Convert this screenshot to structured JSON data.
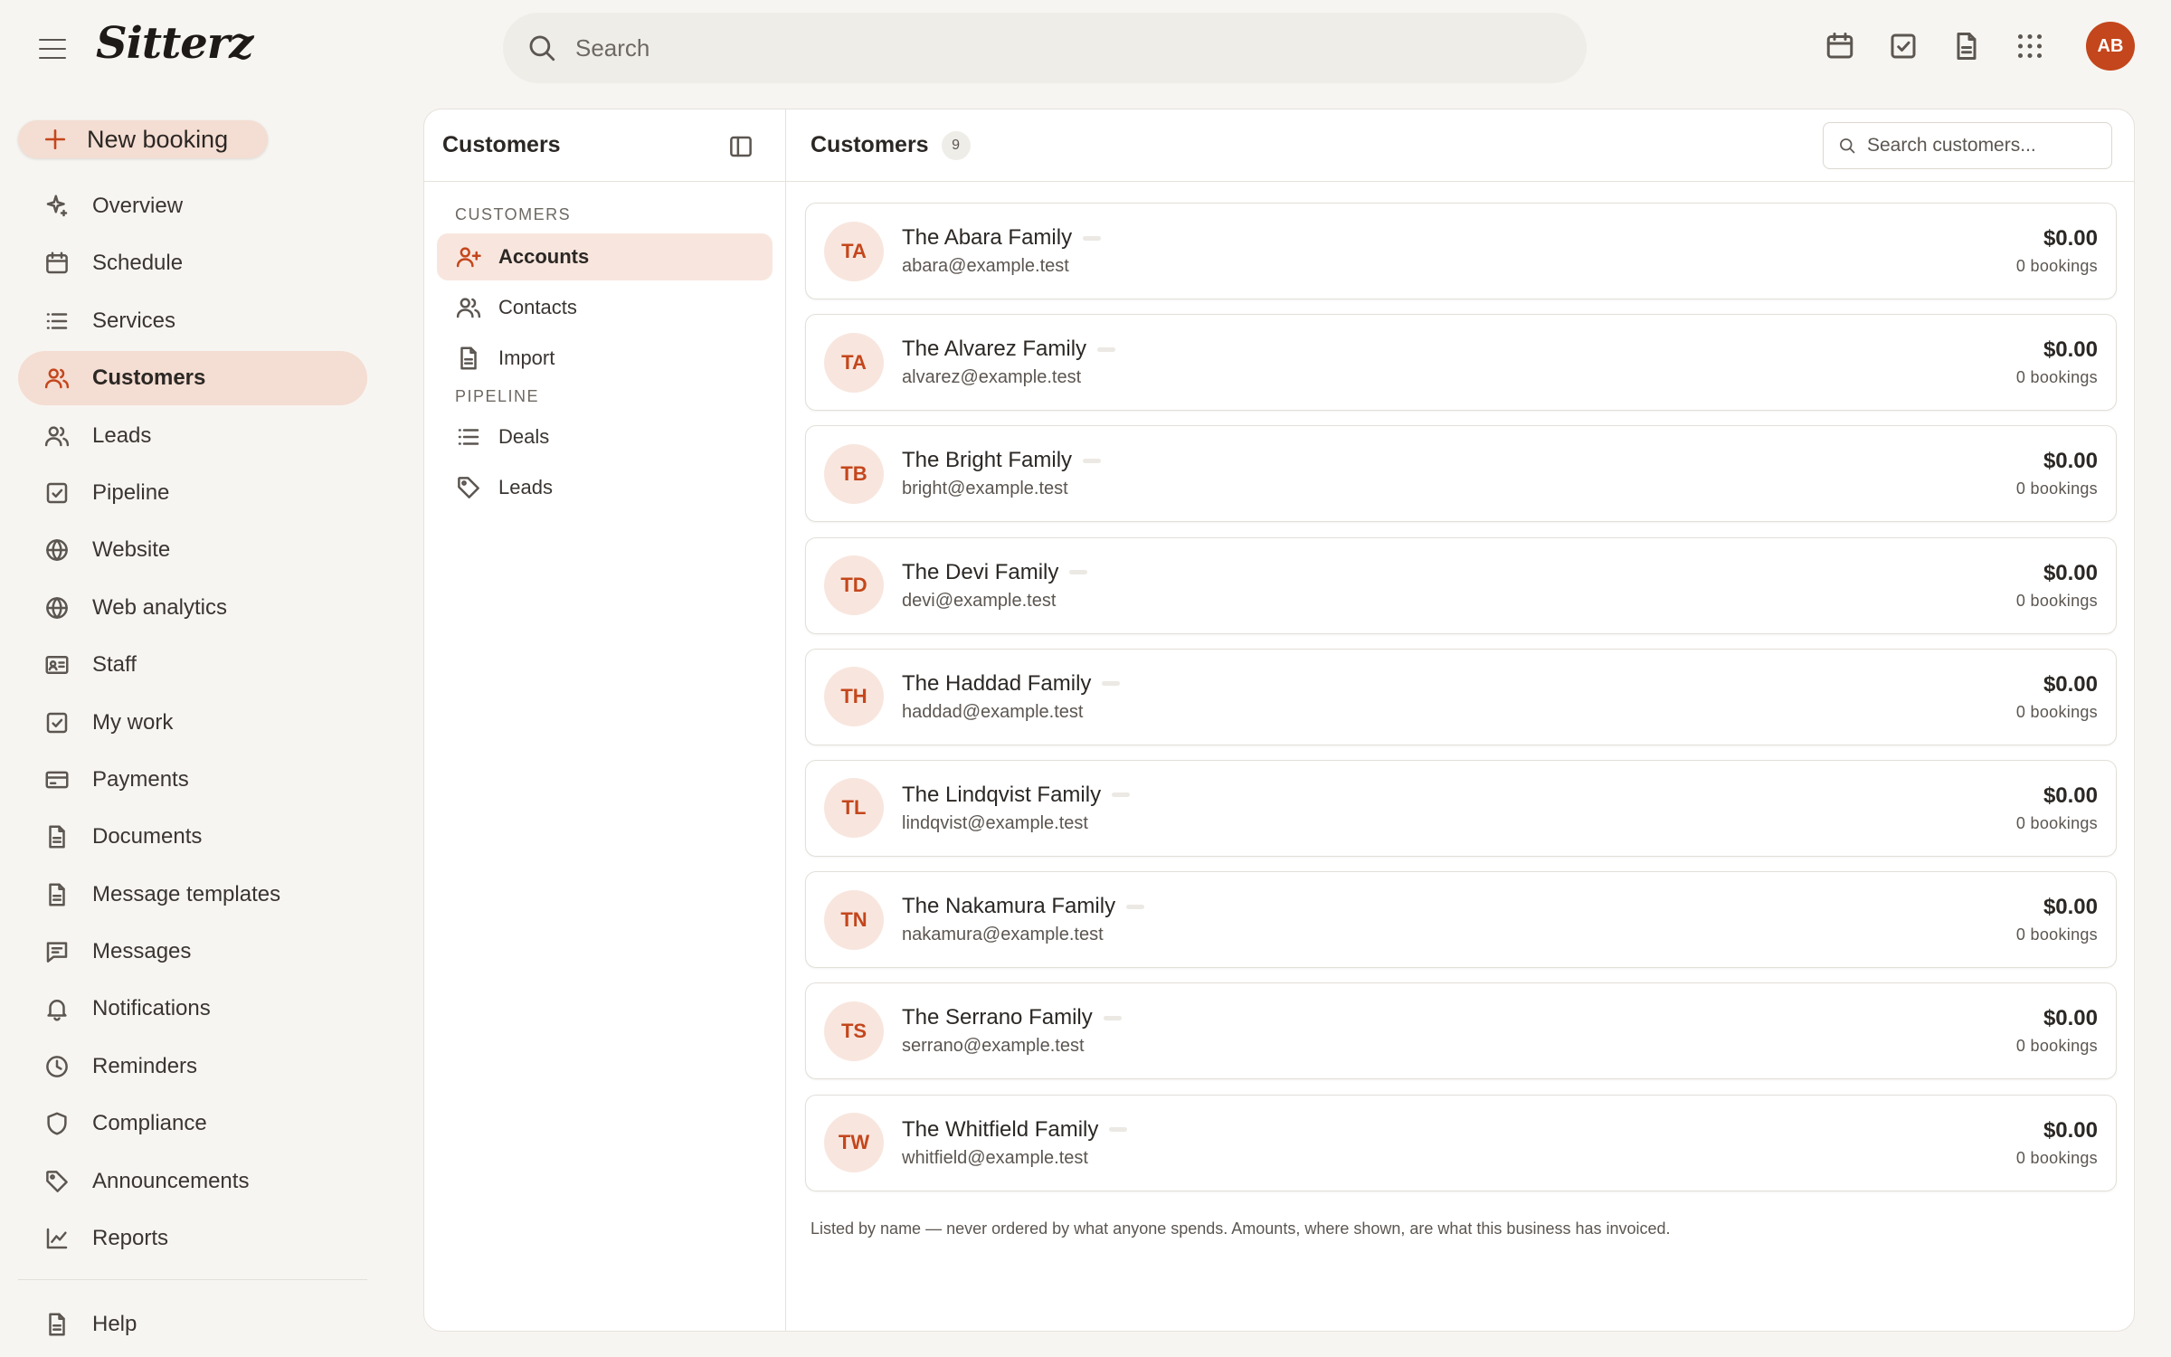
{
  "app": {
    "logo": "Sitterz",
    "user_initials": "AB",
    "accent": "#c4461c"
  },
  "search": {
    "placeholder": "Search"
  },
  "top_icons": [
    "calendar-icon",
    "check-square-icon",
    "document-icon",
    "apps-grid-icon"
  ],
  "sidebar": {
    "new_booking": "New booking",
    "items": [
      {
        "label": "Overview",
        "icon": "sparkle-icon"
      },
      {
        "label": "Schedule",
        "icon": "calendar-icon"
      },
      {
        "label": "Services",
        "icon": "list-icon"
      },
      {
        "label": "Customers",
        "icon": "users-icon",
        "active": true
      },
      {
        "label": "Leads",
        "icon": "users-icon"
      },
      {
        "label": "Pipeline",
        "icon": "check-square-icon"
      },
      {
        "label": "Website",
        "icon": "globe-icon"
      },
      {
        "label": "Web analytics",
        "icon": "globe-icon"
      },
      {
        "label": "Staff",
        "icon": "id-card-icon"
      },
      {
        "label": "My work",
        "icon": "check-square-icon"
      },
      {
        "label": "Payments",
        "icon": "credit-card-icon"
      },
      {
        "label": "Documents",
        "icon": "document-icon"
      },
      {
        "label": "Message templates",
        "icon": "document-icon"
      },
      {
        "label": "Messages",
        "icon": "message-icon"
      },
      {
        "label": "Notifications",
        "icon": "bell-icon"
      },
      {
        "label": "Reminders",
        "icon": "clock-icon"
      },
      {
        "label": "Compliance",
        "icon": "shield-icon"
      },
      {
        "label": "Announcements",
        "icon": "tag-icon"
      },
      {
        "label": "Reports",
        "icon": "chart-icon"
      }
    ],
    "help": {
      "label": "Help",
      "icon": "document-icon"
    }
  },
  "subnav": {
    "title": "Customers",
    "sections": [
      {
        "label": "CUSTOMERS",
        "items": [
          {
            "label": "Accounts",
            "icon": "user-plus-icon",
            "active": true
          },
          {
            "label": "Contacts",
            "icon": "users-icon"
          },
          {
            "label": "Import",
            "icon": "document-icon"
          }
        ]
      },
      {
        "label": "PIPELINE",
        "items": [
          {
            "label": "Deals",
            "icon": "list-icon"
          },
          {
            "label": "Leads",
            "icon": "tag-icon"
          }
        ]
      }
    ]
  },
  "content": {
    "title": "Customers",
    "count": "9",
    "search_placeholder": "Search customers...",
    "customers": [
      {
        "initials": "TA",
        "name": "The Abara Family",
        "email": "abara@example.test",
        "amount": "$0.00",
        "bookings": "0 bookings"
      },
      {
        "initials": "TA",
        "name": "The Alvarez Family",
        "email": "alvarez@example.test",
        "amount": "$0.00",
        "bookings": "0 bookings"
      },
      {
        "initials": "TB",
        "name": "The Bright Family",
        "email": "bright@example.test",
        "amount": "$0.00",
        "bookings": "0 bookings"
      },
      {
        "initials": "TD",
        "name": "The Devi Family",
        "email": "devi@example.test",
        "amount": "$0.00",
        "bookings": "0 bookings"
      },
      {
        "initials": "TH",
        "name": "The Haddad Family",
        "email": "haddad@example.test",
        "amount": "$0.00",
        "bookings": "0 bookings"
      },
      {
        "initials": "TL",
        "name": "The Lindqvist Family",
        "email": "lindqvist@example.test",
        "amount": "$0.00",
        "bookings": "0 bookings"
      },
      {
        "initials": "TN",
        "name": "The Nakamura Family",
        "email": "nakamura@example.test",
        "amount": "$0.00",
        "bookings": "0 bookings"
      },
      {
        "initials": "TS",
        "name": "The Serrano Family",
        "email": "serrano@example.test",
        "amount": "$0.00",
        "bookings": "0 bookings"
      },
      {
        "initials": "TW",
        "name": "The Whitfield Family",
        "email": "whitfield@example.test",
        "amount": "$0.00",
        "bookings": "0 bookings"
      }
    ],
    "footnote": "Listed by name — never ordered by what anyone spends. Amounts, where shown, are what this business has invoiced."
  }
}
